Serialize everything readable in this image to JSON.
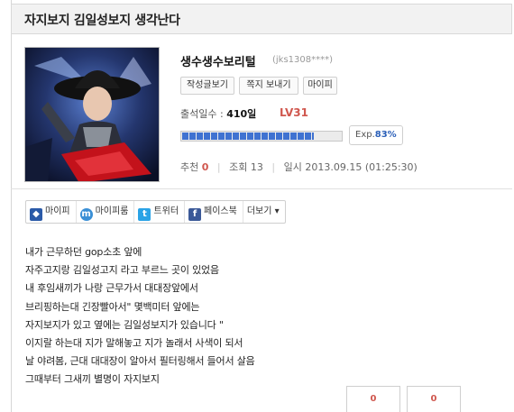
{
  "post": {
    "title": "자지보지 김일성보지 생각난다"
  },
  "profile": {
    "nickname": "생수생수보리털",
    "user_id": "(jks1308****)",
    "buttons": [
      "작성글보기",
      "쪽지 보내기",
      "마이피"
    ],
    "attendance_label": "출석일수 :",
    "attendance_value": "410일",
    "level": "LV31",
    "exp_label": "Exp.",
    "exp_percent": "83%",
    "exp_fraction": 0.83
  },
  "meta": {
    "recommend_label": "추천",
    "recommend_value": "0",
    "views_label": "조회",
    "views_value": "13",
    "date_label": "일시",
    "date_value": "2013.09.15 (01:25:30)"
  },
  "share": [
    {
      "label": "마이피",
      "icon": "mypi-icon",
      "color": "#2a5aa8",
      "glyph": "◆"
    },
    {
      "label": "마이피룸",
      "icon": "mypiroom-icon",
      "color": "#3a8fd6",
      "glyph": "m"
    },
    {
      "label": "트위터",
      "icon": "twitter-icon",
      "color": "#2aa3e6",
      "glyph": "t"
    },
    {
      "label": "페이스북",
      "icon": "facebook-icon",
      "color": "#3b5998",
      "glyph": "f"
    },
    {
      "label": "더보기 ▾",
      "icon": "",
      "color": "",
      "glyph": ""
    }
  ],
  "content_lines": [
    "내가 근무하던 gop소초 앞에",
    "자주고지랑 김일성고지 라고 부르느 곳이 있었음",
    "내 후임새끼가 나랑 근무가서 대대장앞에서",
    "브리핑하는대 긴장빨아서\" 몇백미터 앞에는",
    "자지보지가 있고 옆에는 김일성보지가 있습니다 \"",
    "이지랄 하는대 지가 말해놓고 지가 놀래서 사색이 되서",
    "날 야려봄, 근대 대대장이 알아서 필터링해서 들어서 살음",
    "그때부터 그새끼 별명이 자지보지"
  ],
  "votes": [
    "0",
    "0"
  ]
}
